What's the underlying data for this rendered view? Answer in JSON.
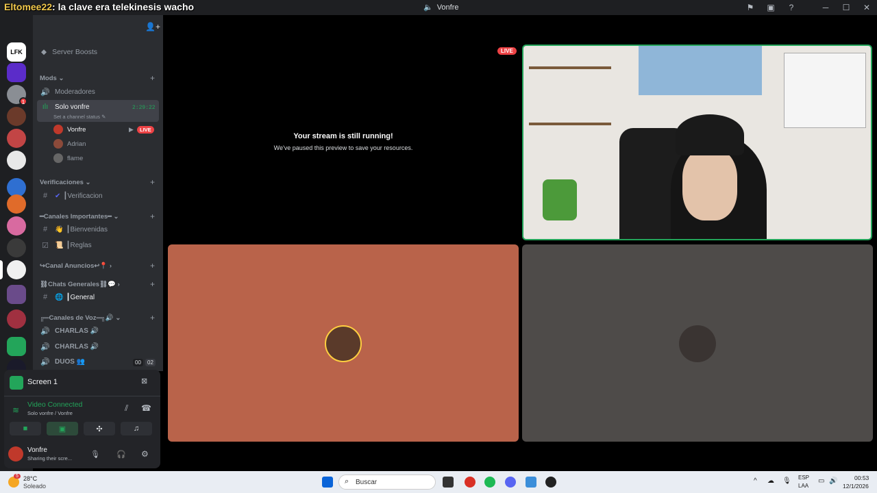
{
  "overlay": {
    "user": "Eltomee22",
    "message": ": la clave era telekinesis wacho"
  },
  "window": {
    "title": "Vonfre"
  },
  "server_header": {
    "boosts": "Server Boosts"
  },
  "categories": {
    "mods": "Mods",
    "verificaciones": "Verificaciones",
    "importantes": "━Canales Importantes━",
    "anuncios": "↪Canal Anuncios↩📍",
    "generales": "⛓Chats Generales⛓💬",
    "voz": "╔═Canales de Voz═╗🔊"
  },
  "channels": {
    "moderadores": "Moderadores",
    "solo_vonfre": "Solo vonfre",
    "solo_vonfre_timer": "2:29:22",
    "solo_vonfre_status": "Set a channel status",
    "verificacion": "┃Verificacion",
    "bienvenidas": "┃Bienvenidas",
    "reglas": "┃Reglas",
    "general": "┃General",
    "charlas1": "CHARLAS 🔊",
    "charlas2": "CHARLAS 🔊",
    "duos": "DUOS 👥",
    "duos_count1": "00",
    "duos_count2": "02"
  },
  "voice_users": [
    {
      "name": "Vonfre",
      "live": "LIVE"
    },
    {
      "name": "Adrian"
    },
    {
      "name": "flame"
    }
  ],
  "panel": {
    "screen": "Screen 1",
    "status": "Video Connected",
    "channel": "Solo vonfre / Vonfre",
    "user": "Vonfre",
    "user_status": "Sharing their scre..."
  },
  "stream": {
    "live": "LIVE",
    "title": "Your stream is still running!",
    "subtitle": "We've paused this preview to save your resources."
  },
  "taskbar": {
    "temp": "28°C",
    "weather": "Soleado",
    "weather_badge": "5",
    "search": "Buscar",
    "lang1": "ESP",
    "lang2": "LAA",
    "time": "00:53",
    "date": "12/1/2026"
  },
  "colors": {
    "tile_orange": "#b9634a",
    "tile_gray": "#4e4b49",
    "accent_green": "#23a55a",
    "live_red": "#ed4245"
  }
}
